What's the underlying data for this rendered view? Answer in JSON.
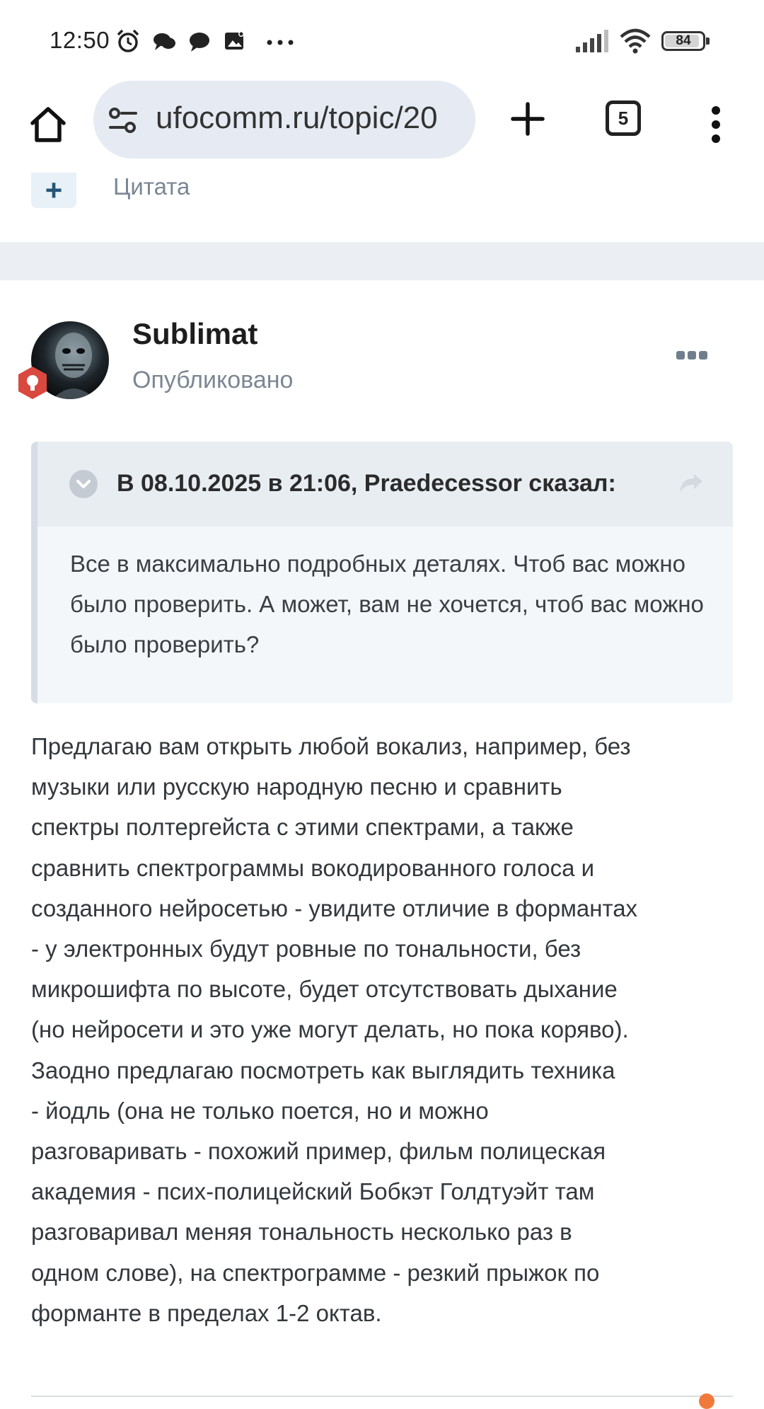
{
  "status_bar": {
    "time": "12:50",
    "icons": [
      "alarm-icon",
      "chat-bubbles-icon",
      "message-icon",
      "gallery-icon",
      "more-dots-icon"
    ],
    "right_icons": [
      "signal-icon",
      "wifi-icon",
      "battery-icon"
    ],
    "battery": "84"
  },
  "browser": {
    "url": "ufocomm.ru/topic/20",
    "tabs_count": "5",
    "icons": [
      "home-icon",
      "site-settings-icon",
      "plus-icon",
      "tabs-icon",
      "kebab-menu-icon"
    ]
  },
  "prev_post": {
    "quote_label": "Цитата"
  },
  "post": {
    "author": "Sublimat",
    "status": "Опубликовано",
    "quote": {
      "citation": "В 08.10.2025 в 21:06, Praedecessor сказал:",
      "text": "Все в максимально подробных  деталях. Чтоб вас можно было проверить. А может, вам не хочется, чтоб вас можно было проверить?"
    },
    "lines": [
      "Предлагаю вам открыть любой вокализ, например, без",
      "музыки или русскую народную песню и сравнить",
      "спектры полтергейста с этими спектрами, а также",
      "сравнить спектрограммы вокодированного голоса и",
      "созданного нейросетью - увидите отличие в формантах",
      "- у электронных будут ровные по тональности, без",
      "микрошифта по высоте, будет отсутствовать дыхание",
      "(но нейросети и это уже могут делать, но пока коряво).",
      "Заодно предлагаю посмотреть как выглядить техника",
      "- йодль (она не только поется, но и можно",
      "разговаривать - похожий пример, фильм полицеская",
      "академия - псих-полицейский Бобкэт Голдтуэйт там",
      "разговаривал меняя тональность несколько раз в",
      "одном слове), на спектрограмме - резкий прыжок по",
      "форманте в пределах 1-2 октав."
    ]
  },
  "colors": {
    "accent": "#245579",
    "badge": "#d9493f",
    "page_gap": "#ebeef2"
  }
}
